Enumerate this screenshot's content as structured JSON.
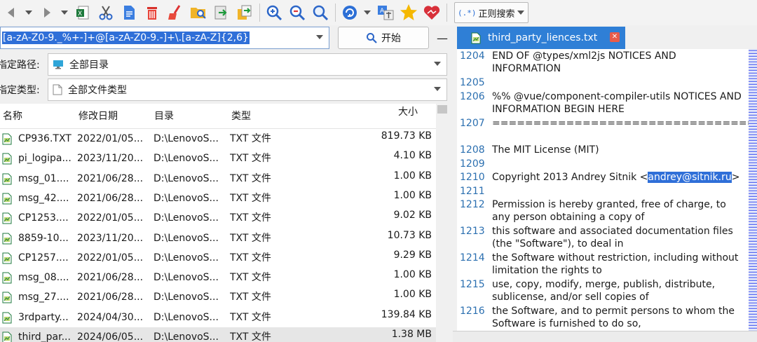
{
  "toolbar": {
    "mode_label": "正则搜索",
    "mode_icon_text": "(.*)"
  },
  "search": {
    "regex": "[a-zA-Z0-9._%+-]+@[a-zA-Z0-9.-]+\\.[a-zA-Z]{2,6}",
    "start_label": "开始",
    "minimize_label": "—"
  },
  "path": {
    "label": "指定路径:",
    "value": "全部目录"
  },
  "filetype": {
    "label": "指定类型:",
    "value": "全部文件类型"
  },
  "table": {
    "columns": [
      "名称",
      "修改日期",
      "目录",
      "类型",
      "大小"
    ],
    "rows": [
      {
        "name": "CP936.TXT",
        "date": "2022/01/05...",
        "dir": "D:\\LenovoS...",
        "type": "TXT 文件",
        "size": "819.73 KB"
      },
      {
        "name": "pi_logipa...",
        "date": "2023/11/20...",
        "dir": "D:\\LenovoS...",
        "type": "TXT 文件",
        "size": "4.10 KB"
      },
      {
        "name": "msg_01....",
        "date": "2021/06/28...",
        "dir": "D:\\LenovoS...",
        "type": "TXT 文件",
        "size": "1.00 KB"
      },
      {
        "name": "msg_42....",
        "date": "2021/06/28...",
        "dir": "D:\\LenovoS...",
        "type": "TXT 文件",
        "size": "1.00 KB"
      },
      {
        "name": "CP1253....",
        "date": "2022/01/05...",
        "dir": "D:\\LenovoS...",
        "type": "TXT 文件",
        "size": "9.02 KB"
      },
      {
        "name": "8859-10...",
        "date": "2023/11/20...",
        "dir": "D:\\LenovoS...",
        "type": "TXT 文件",
        "size": "10.73 KB"
      },
      {
        "name": "CP1257....",
        "date": "2022/01/05...",
        "dir": "D:\\LenovoS...",
        "type": "TXT 文件",
        "size": "9.29 KB"
      },
      {
        "name": "msg_08....",
        "date": "2021/06/28...",
        "dir": "D:\\LenovoS...",
        "type": "TXT 文件",
        "size": "1.00 KB"
      },
      {
        "name": "msg_27....",
        "date": "2021/06/28...",
        "dir": "D:\\LenovoS...",
        "type": "TXT 文件",
        "size": "1.00 KB"
      },
      {
        "name": "3rdparty...",
        "date": "2024/04/30...",
        "dir": "D:\\LenovoS...",
        "type": "TXT 文件",
        "size": "139.84 KB"
      },
      {
        "name": "third_par...",
        "date": "2024/06/05...",
        "dir": "D:\\LenovoS...",
        "type": "TXT 文件",
        "size": "1.38 MB"
      }
    ]
  },
  "editor": {
    "tab_label": "third_party_liences.txt",
    "lines": [
      {
        "num": "1204",
        "text": "END OF @types/xml2js NOTICES AND INFORMATION"
      },
      {
        "num": "1205",
        "text": ""
      },
      {
        "num": "1206",
        "text": "%% @vue/component-compiler-utils NOTICES AND INFORMATION BEGIN HERE"
      },
      {
        "num": "1207",
        "text": "========================================"
      },
      {
        "num": "1208",
        "text": "The MIT License (MIT)"
      },
      {
        "num": "1209",
        "text": ""
      },
      {
        "num": "1210",
        "text_before": "Copyright 2013 Andrey Sitnik <",
        "text_match": "andrey@sitnik.ru",
        "text_after": ">"
      },
      {
        "num": "1211",
        "text": ""
      },
      {
        "num": "1212",
        "text": "Permission is hereby granted, free of charge, to any person obtaining a copy of"
      },
      {
        "num": "1213",
        "text": "this software and associated documentation files (the \"Software\"), to deal in"
      },
      {
        "num": "1214",
        "text": "the Software without restriction, including without limitation the rights to"
      },
      {
        "num": "1215",
        "text": "use, copy, modify, merge, publish, distribute, sublicense, and/or sell copies of"
      },
      {
        "num": "1216",
        "text": "the Software, and to permit persons to whom the Software is furnished to do so,"
      }
    ]
  },
  "colors": {
    "accent": "#2f7fd6",
    "selection": "#2f6fd8",
    "line_number": "#2b6fb0"
  }
}
